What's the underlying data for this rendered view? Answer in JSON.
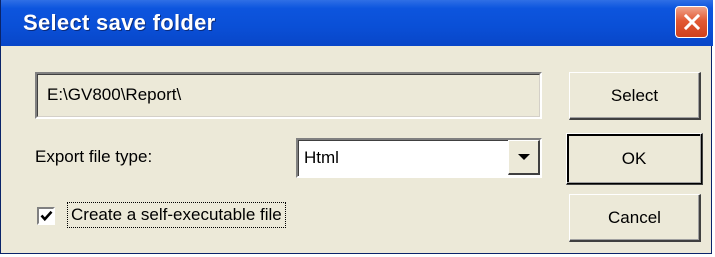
{
  "window": {
    "title": "Select save folder"
  },
  "path": {
    "value": "E:\\GV800\\Report\\"
  },
  "export": {
    "label": "Export file type:",
    "selected": "Html"
  },
  "checkbox": {
    "label": "Create a self-executable file",
    "checked": true
  },
  "buttons": {
    "select": "Select",
    "ok": "OK",
    "cancel": "Cancel"
  },
  "icons": {
    "close": "close-icon",
    "dropdown": "chevron-down-icon",
    "check": "checkmark-icon"
  },
  "colors": {
    "titlebar": "#0a4fd6",
    "close_button": "#d9512a",
    "dialog_face": "#ece9d8"
  }
}
